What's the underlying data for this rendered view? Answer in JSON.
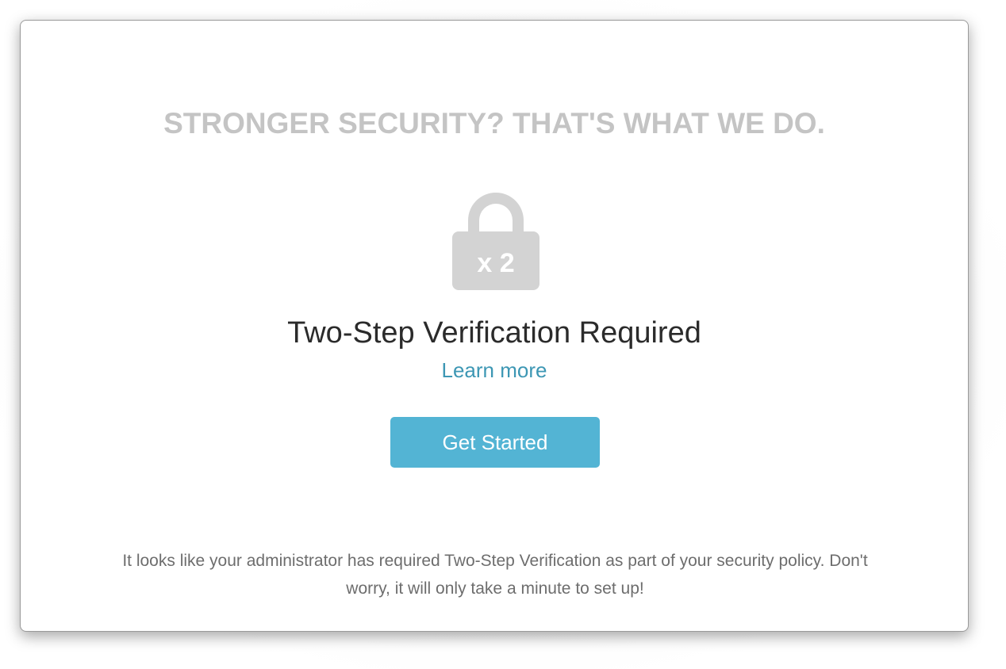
{
  "modal": {
    "headline": "STRONGER SECURITY? THAT'S WHAT WE DO.",
    "lock_icon": {
      "name": "padlock-icon",
      "label": "x 2",
      "color": "#d3d3d3"
    },
    "title": "Two-Step Verification Required",
    "learn_more_label": "Learn more",
    "get_started_label": "Get Started",
    "footnote": "It looks like your administrator has required Two-Step Verification as part of your security policy. Don't worry, it will only take a minute to set up!"
  },
  "colors": {
    "headline": "#c4c4c4",
    "title": "#2b2b2b",
    "link": "#3d97b4",
    "button": "#53b4d4",
    "footnote": "#6d6d6d"
  }
}
